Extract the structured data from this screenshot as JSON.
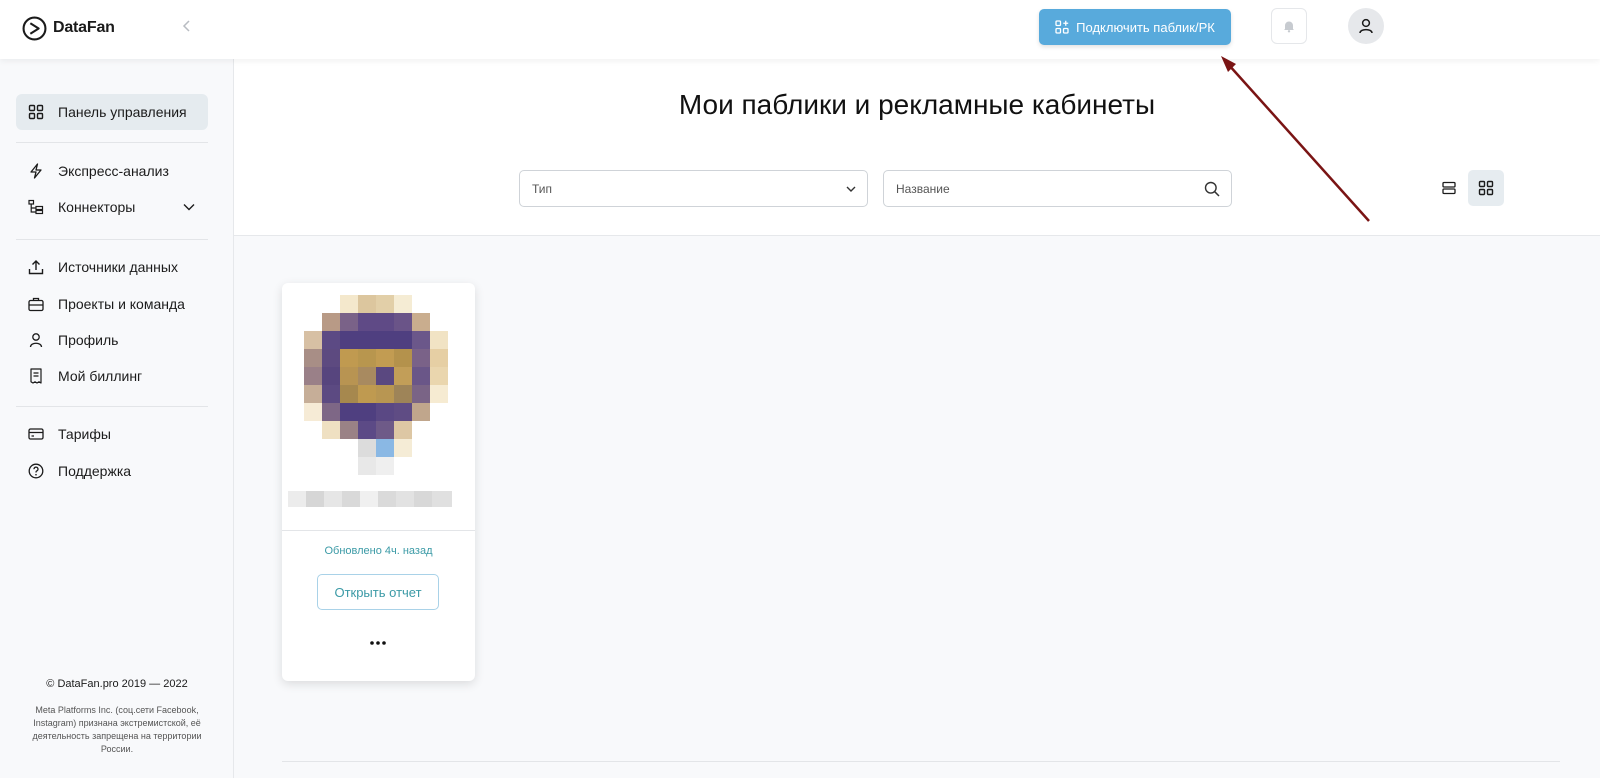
{
  "brand": {
    "name": "DataFan"
  },
  "header": {
    "connect_button": "Подключить паблик/РК"
  },
  "sidebar": {
    "items": [
      {
        "label": "Панель управления",
        "icon": "dashboard-grid-icon",
        "active": true
      },
      {
        "label": "Экспресс-анализ",
        "icon": "lightning-icon"
      },
      {
        "label": "Коннекторы",
        "icon": "connectors-tree-icon",
        "expandable": true
      },
      {
        "label": "Источники данных",
        "icon": "upload-icon"
      },
      {
        "label": "Проекты и команда",
        "icon": "briefcase-icon"
      },
      {
        "label": "Профиль",
        "icon": "user-icon"
      },
      {
        "label": "Мой биллинг",
        "icon": "receipt-icon"
      },
      {
        "label": "Тарифы",
        "icon": "credit-card-icon"
      },
      {
        "label": "Поддержка",
        "icon": "help-circle-icon"
      }
    ],
    "copyright": "© DataFan.pro 2019 — 2022",
    "disclaimer": "Meta Platforms Inc. (соц.сети Facebook, Instagram) признана экстремистской, её деятельность запрещена на территории России."
  },
  "main": {
    "title": "Мои паблики и рекламные кабинеты",
    "filters": {
      "type_placeholder": "Тип",
      "name_placeholder": "Название"
    },
    "active_view": "grid"
  },
  "card": {
    "updated": "Обновлено 4ч. назад",
    "open_report": "Открыть отчет",
    "more": "•••"
  },
  "colors": {
    "accent": "#58aadc",
    "teal_text": "#3b9aa6",
    "annotation_arrow": "#7a1414"
  }
}
